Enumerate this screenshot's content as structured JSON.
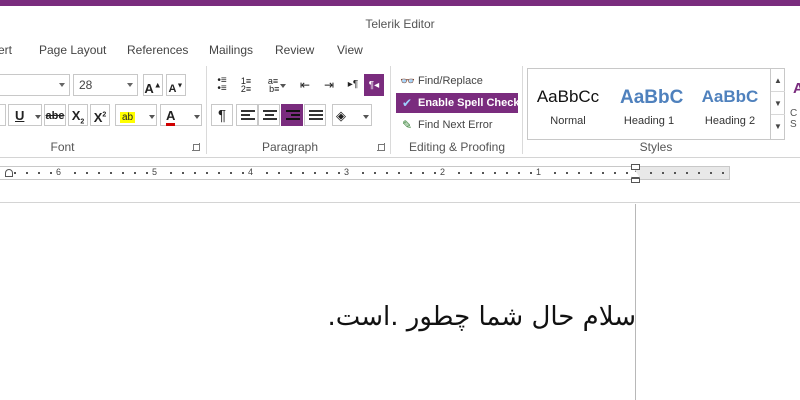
{
  "window": {
    "title": "Telerik Editor",
    "accent_color": "#7a2c7e"
  },
  "tabs": [
    {
      "label": "ert"
    },
    {
      "label": "Page Layout"
    },
    {
      "label": "References"
    },
    {
      "label": "Mailings"
    },
    {
      "label": "Review"
    },
    {
      "label": "View"
    }
  ],
  "font_group": {
    "label": "Font",
    "font_size": "28",
    "grow_icon": "A-grow-icon",
    "shrink_icon": "A-shrink-icon",
    "buttons": {
      "underline": "U",
      "strikethrough": "abe",
      "subscript": "X",
      "subscript_mark": "2",
      "superscript": "X",
      "superscript_mark": "2",
      "highlight": "ab",
      "font_color": "A"
    },
    "highlight_color": "#ffff00",
    "font_color_value": "#d00000"
  },
  "paragraph_group": {
    "label": "Paragraph",
    "pilcrow": "¶",
    "ltr_label": "▸¶",
    "rtl_label": "¶◂"
  },
  "editing_group": {
    "label": "Editing & Proofing",
    "find_replace": "Find/Replace",
    "spell_check": "Enable Spell Check",
    "find_next_error": "Find Next Error"
  },
  "styles_group": {
    "label": "Styles",
    "items": [
      {
        "preview": "AaBbCc",
        "name": "Normal"
      },
      {
        "preview": "AaBbC",
        "name": "Heading 1"
      },
      {
        "preview": "AaBbC",
        "name": "Heading 2"
      }
    ],
    "heading_color": "#4f81bd",
    "partial_label_top": "A",
    "partial_label_1": "C",
    "partial_label_2": "S"
  },
  "ruler": {
    "numbers": [
      "6",
      "5",
      "4",
      "3",
      "2",
      "1"
    ]
  },
  "document": {
    "text": "سلام حال شما چطور .است."
  }
}
